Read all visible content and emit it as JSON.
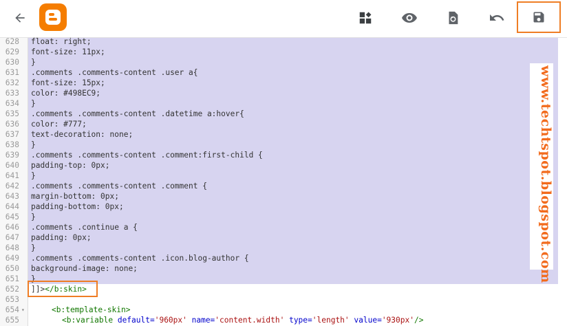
{
  "toolbar": {
    "back_icon": "arrow-left-icon",
    "logo_icon": "blogger-logo-icon",
    "layout_icon": "layout-widgets-icon",
    "preview_icon": "eye-icon",
    "revert_icon": "revert-file-icon",
    "undo_icon": "undo-icon",
    "save_icon": "floppy-save-icon",
    "accent_color": "#ef7d24"
  },
  "editor": {
    "lines": [
      {
        "n": "628",
        "text": "float: right;"
      },
      {
        "n": "629",
        "text": "font-size: 11px;"
      },
      {
        "n": "630",
        "text": "}"
      },
      {
        "n": "631",
        "text": ".comments .comments-content .user a{"
      },
      {
        "n": "632",
        "text": "font-size: 15px;"
      },
      {
        "n": "633",
        "text": "color: #498EC9;"
      },
      {
        "n": "634",
        "text": "}"
      },
      {
        "n": "635",
        "text": ".comments .comments-content .datetime a:hover{"
      },
      {
        "n": "636",
        "text": "color: #777;"
      },
      {
        "n": "637",
        "text": "text-decoration: none;"
      },
      {
        "n": "638",
        "text": "}"
      },
      {
        "n": "639",
        "text": ".comments .comments-content .comment:first-child {"
      },
      {
        "n": "640",
        "text": "padding-top: 0px;"
      },
      {
        "n": "641",
        "text": "}"
      },
      {
        "n": "642",
        "text": ".comments .comments-content .comment {"
      },
      {
        "n": "643",
        "text": "margin-bottom: 0px;"
      },
      {
        "n": "644",
        "text": "padding-bottom: 0px;"
      },
      {
        "n": "645",
        "text": "}"
      },
      {
        "n": "646",
        "text": ".comments .continue a {"
      },
      {
        "n": "647",
        "text": "padding: 0px;"
      },
      {
        "n": "648",
        "text": "}"
      },
      {
        "n": "649",
        "text": ".comments .comments-content .icon.blog-author {"
      },
      {
        "n": "650",
        "text": "background-image: none;"
      },
      {
        "n": "651",
        "text": "}"
      },
      {
        "n": "652",
        "text": "]]></b:skin>"
      },
      {
        "n": "653",
        "text": ""
      },
      {
        "n": "654",
        "text": "<b:template-skin>"
      },
      {
        "n": "655",
        "text": "<b:variable default='960px' name='content.width' type='length' value='930px'/>"
      }
    ]
  },
  "watermark": "www.techtspot.blogspot.com"
}
